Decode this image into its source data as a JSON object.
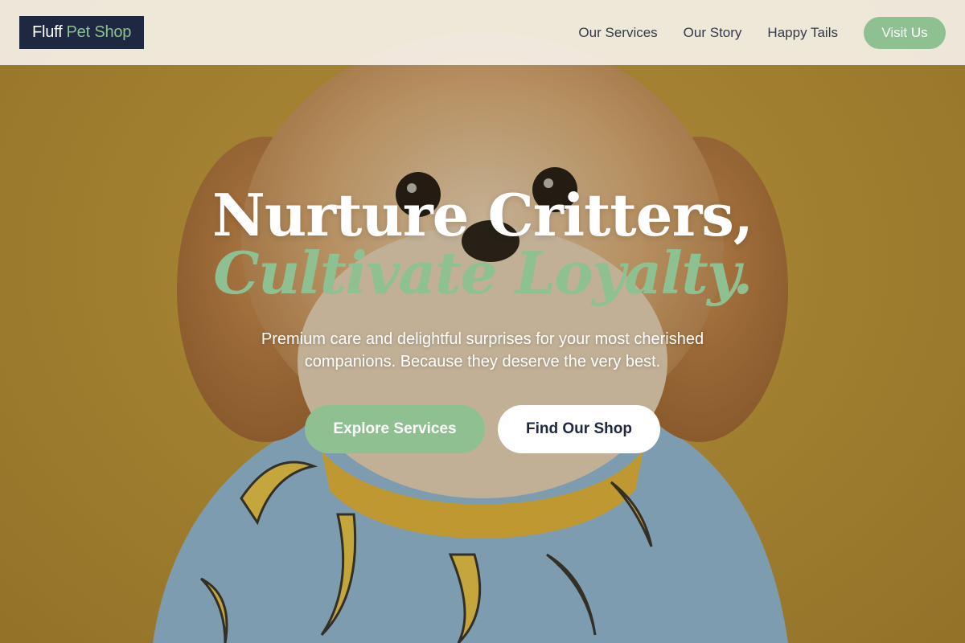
{
  "header": {
    "logo_part1": "Fluff",
    "logo_part2": "Pet Shop",
    "nav": [
      "Our Services",
      "Our Story",
      "Happy Tails"
    ],
    "cta_label": "Visit Us"
  },
  "hero": {
    "title_line1": "Nurture Critters,",
    "title_line2": "Cultivate Loyalty.",
    "subtitle": "Premium care and delightful surprises for your most cherished companions. Because they deserve the very best.",
    "primary_button": "Explore Services",
    "secondary_button": "Find Our Shop",
    "image": "dog-in-banana-shirt-photo"
  },
  "colors": {
    "header_bg": "#f4f0e6",
    "logo_bg": "#1e2840",
    "accent_green": "#8fc092",
    "nav_text": "#33394a",
    "hero_bg": "#b99238"
  }
}
